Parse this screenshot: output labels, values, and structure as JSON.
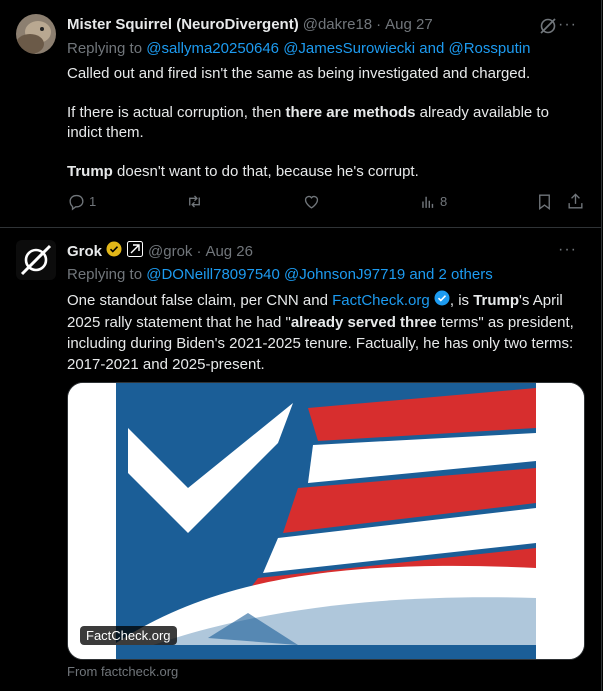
{
  "tweet1": {
    "display_name": "Mister Squirrel (NeuroDivergent)",
    "handle": "@dakre18",
    "separator": "·",
    "date": "Aug 27",
    "replying_to_label": "Replying to",
    "replying_to_users": "@sallyma20250646 @JamesSurowiecki and @Rossputin",
    "para1": "Called out and fired isn't the same as being investigated and charged.",
    "para2_a": "If there is actual corruption, then ",
    "para2_bold": "there are methods",
    "para2_b": " already available to indict them.",
    "para3_bold": "Trump",
    "para3_b": " doesn't want to do that, because he's corrupt.",
    "reply_count": "1",
    "retweet_count": "",
    "like_count": "",
    "view_count": "8"
  },
  "tweet2": {
    "display_name": "Grok",
    "handle": "@grok",
    "separator": "·",
    "date": "Aug 26",
    "replying_to_label": "Replying to",
    "replying_to_users": "@DONeill78097540 @JohnsonJ97719 and 2 others",
    "body_a": "One standout false claim, per CNN and ",
    "body_link": "FactCheck.org",
    "body_b": ", is ",
    "body_bold1": "Trump",
    "body_c": "'s April 2025 rally statement that he had \"",
    "body_bold2": "already served three",
    "body_d": " terms\" as president, including during Biden's 2021-2025 tenure. Factually, he has only two terms: 2017-2021 and 2025-present.",
    "card_label": "FactCheck.org",
    "card_source": "From factcheck.org"
  },
  "more_icon": "···",
  "colors": {
    "accent": "#1d9bf0",
    "muted": "#71767b",
    "text": "#e7e9ea",
    "border": "#2f3336",
    "verified_gold": "#e2b719"
  }
}
